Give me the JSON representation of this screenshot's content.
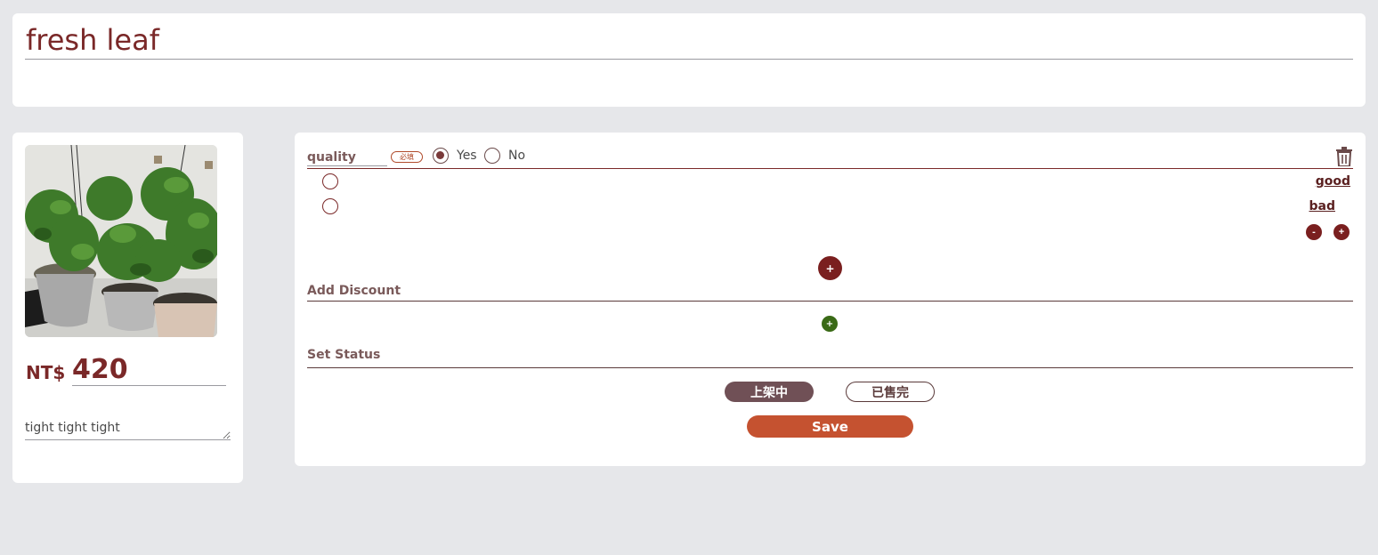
{
  "product": {
    "title": "fresh leaf",
    "currency": "NT$",
    "price": "420",
    "note": "tight tight tight"
  },
  "option_group": {
    "name": "quality",
    "required_label": "必填",
    "required_yes_label": "Yes",
    "required_no_label": "No",
    "required_selected": "Yes",
    "items": [
      {
        "label": "good"
      },
      {
        "label": "bad"
      }
    ],
    "remove_item_label": "-",
    "add_item_label": "+"
  },
  "add_option_group_label": "+",
  "discount": {
    "heading": "Add Discount",
    "add_label": "+"
  },
  "status": {
    "heading": "Set Status",
    "on_sale_label": "上架中",
    "sold_out_label": "已售完",
    "selected": "上架中"
  },
  "save_label": "Save",
  "colors": {
    "brand": "#7a2828",
    "save": "#c55230",
    "discount_add": "#3a6a16",
    "status_selected": "#705056"
  }
}
